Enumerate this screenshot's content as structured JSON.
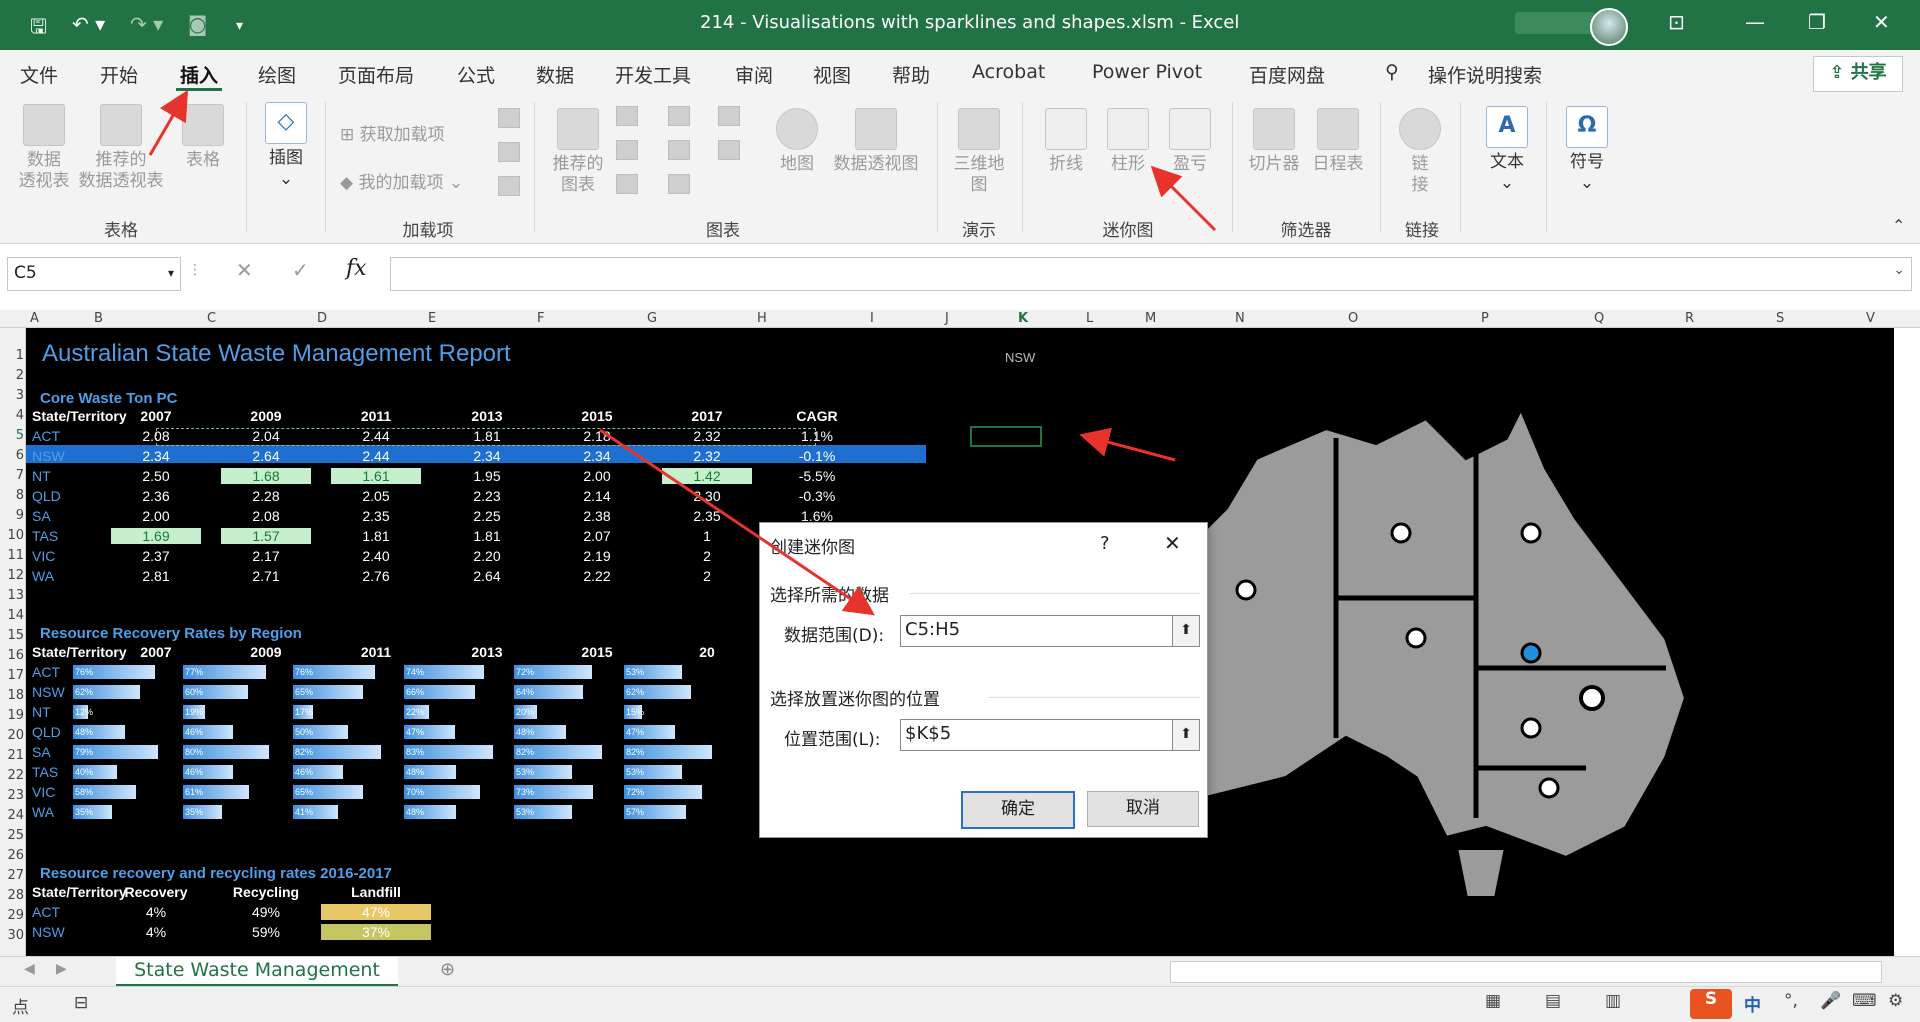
{
  "window": {
    "title": "214 - Visualisations with sparklines and shapes.xlsm  -  Excel",
    "brand_color": "#217346"
  },
  "ribbon_tabs": [
    "文件",
    "开始",
    "插入",
    "绘图",
    "页面布局",
    "公式",
    "数据",
    "开发工具",
    "审阅",
    "视图",
    "帮助",
    "Acrobat",
    "Power Pivot",
    "百度网盘",
    "操作说明搜索"
  ],
  "active_tab": "插入",
  "share_label": "共享",
  "ribbon": {
    "pivot_table": "数据\n透视表",
    "rec_pivot": "推荐的\n数据透视表",
    "table": "表格",
    "group_tables": "表格",
    "illustrations": "插图",
    "get_addins": "获取加载项",
    "my_addins": "我的加载项",
    "group_addins": "加载项",
    "rec_charts": "推荐的\n图表",
    "maps": "地图",
    "pivot_chart": "数据透视图",
    "group_charts": "图表",
    "map3d": "三维地\n图",
    "group_tours": "演示",
    "spark_line": "折线",
    "spark_column": "柱形",
    "spark_winloss": "盈亏",
    "group_sparklines": "迷你图",
    "slicer": "切片器",
    "timeline": "日程表",
    "group_filters": "筛选器",
    "link": "链\n接",
    "group_links": "链接",
    "text": "文本",
    "symbols": "符号"
  },
  "formula_bar": {
    "name_box": "C5",
    "formula": ""
  },
  "columns": [
    "A",
    "B",
    "C",
    "D",
    "E",
    "F",
    "G",
    "H",
    "I",
    "J",
    "K",
    "L",
    "M",
    "N",
    "O",
    "P",
    "Q",
    "R",
    "S",
    "V"
  ],
  "rows": [
    "1",
    "2",
    "3",
    "4",
    "5",
    "6",
    "7",
    "8",
    "9",
    "10",
    "11",
    "12",
    "13",
    "14",
    "15",
    "16",
    "17",
    "18",
    "19",
    "20",
    "21",
    "22",
    "23",
    "24",
    "25",
    "26",
    "27",
    "28",
    "29",
    "30"
  ],
  "sheet": {
    "title": "Australian State Waste Management Report",
    "k1_label": "NSW",
    "section1": {
      "title": "Core Waste Ton PC",
      "headers": [
        "State/Territory",
        "2007",
        "2009",
        "2011",
        "2013",
        "2015",
        "2017",
        "CAGR"
      ],
      "rows": [
        [
          "ACT",
          "2.08",
          "2.04",
          "2.44",
          "1.81",
          "2.18",
          "2.32",
          "1.1%"
        ],
        [
          "NSW",
          "2.34",
          "2.64",
          "2.44",
          "2.34",
          "2.34",
          "2.32",
          "-0.1%"
        ],
        [
          "NT",
          "2.50",
          "1.68",
          "1.61",
          "1.95",
          "2.00",
          "1.42",
          "-5.5%"
        ],
        [
          "QLD",
          "2.36",
          "2.28",
          "2.05",
          "2.23",
          "2.14",
          "2.30",
          "-0.3%"
        ],
        [
          "SA",
          "2.00",
          "2.08",
          "2.35",
          "2.25",
          "2.38",
          "2.35",
          "1.6%"
        ],
        [
          "TAS",
          "1.69",
          "1.57",
          "1.81",
          "1.81",
          "2.07",
          "1",
          ""
        ],
        [
          "VIC",
          "2.37",
          "2.17",
          "2.40",
          "2.20",
          "2.19",
          "2",
          ""
        ],
        [
          "WA",
          "2.81",
          "2.71",
          "2.76",
          "2.64",
          "2.22",
          "2",
          ""
        ]
      ]
    },
    "section2": {
      "title": "Resource Recovery Rates by Region",
      "headers": [
        "State/Territory",
        "2007",
        "2009",
        "2011",
        "2013",
        "2015",
        "20"
      ],
      "rows": [
        [
          "ACT",
          "76%",
          "77%",
          "76%",
          "74%",
          "72%",
          "53%"
        ],
        [
          "NSW",
          "62%",
          "60%",
          "65%",
          "66%",
          "64%",
          "62%"
        ],
        [
          "NT",
          "12%",
          "19%",
          "17%",
          "22%",
          "20%",
          "15%"
        ],
        [
          "QLD",
          "48%",
          "46%",
          "50%",
          "47%",
          "48%",
          "47%"
        ],
        [
          "SA",
          "79%",
          "80%",
          "82%",
          "83%",
          "82%",
          "82%"
        ],
        [
          "TAS",
          "40%",
          "46%",
          "46%",
          "48%",
          "53%",
          "53%"
        ],
        [
          "VIC",
          "58%",
          "61%",
          "65%",
          "70%",
          "73%",
          "72%"
        ],
        [
          "WA",
          "35%",
          "35%",
          "41%",
          "48%",
          "53%",
          "57%"
        ]
      ]
    },
    "section3": {
      "title": "Resource recovery and recycling rates 2016-2017",
      "headers": [
        "State/Territory",
        "Recovery",
        "Recycling",
        "Landfill"
      ],
      "rows": [
        [
          "ACT",
          "4%",
          "49%",
          "47%"
        ],
        [
          "NSW",
          "4%",
          "59%",
          "37%"
        ]
      ]
    }
  },
  "dialog": {
    "title": "创建迷你图",
    "help": "?",
    "close": "✕",
    "section1": "选择所需的数据",
    "data_range_label": "数据范围(D):",
    "data_range_value": "C5:H5",
    "section2": "选择放置迷你图的位置",
    "location_label": "位置范围(L):",
    "location_value": "$K$5",
    "ok": "确定",
    "cancel": "取消"
  },
  "sheet_tab": "State Waste Management",
  "status": {
    "mode": "点",
    "ime": "中"
  },
  "map_color": "#9b9b9b"
}
